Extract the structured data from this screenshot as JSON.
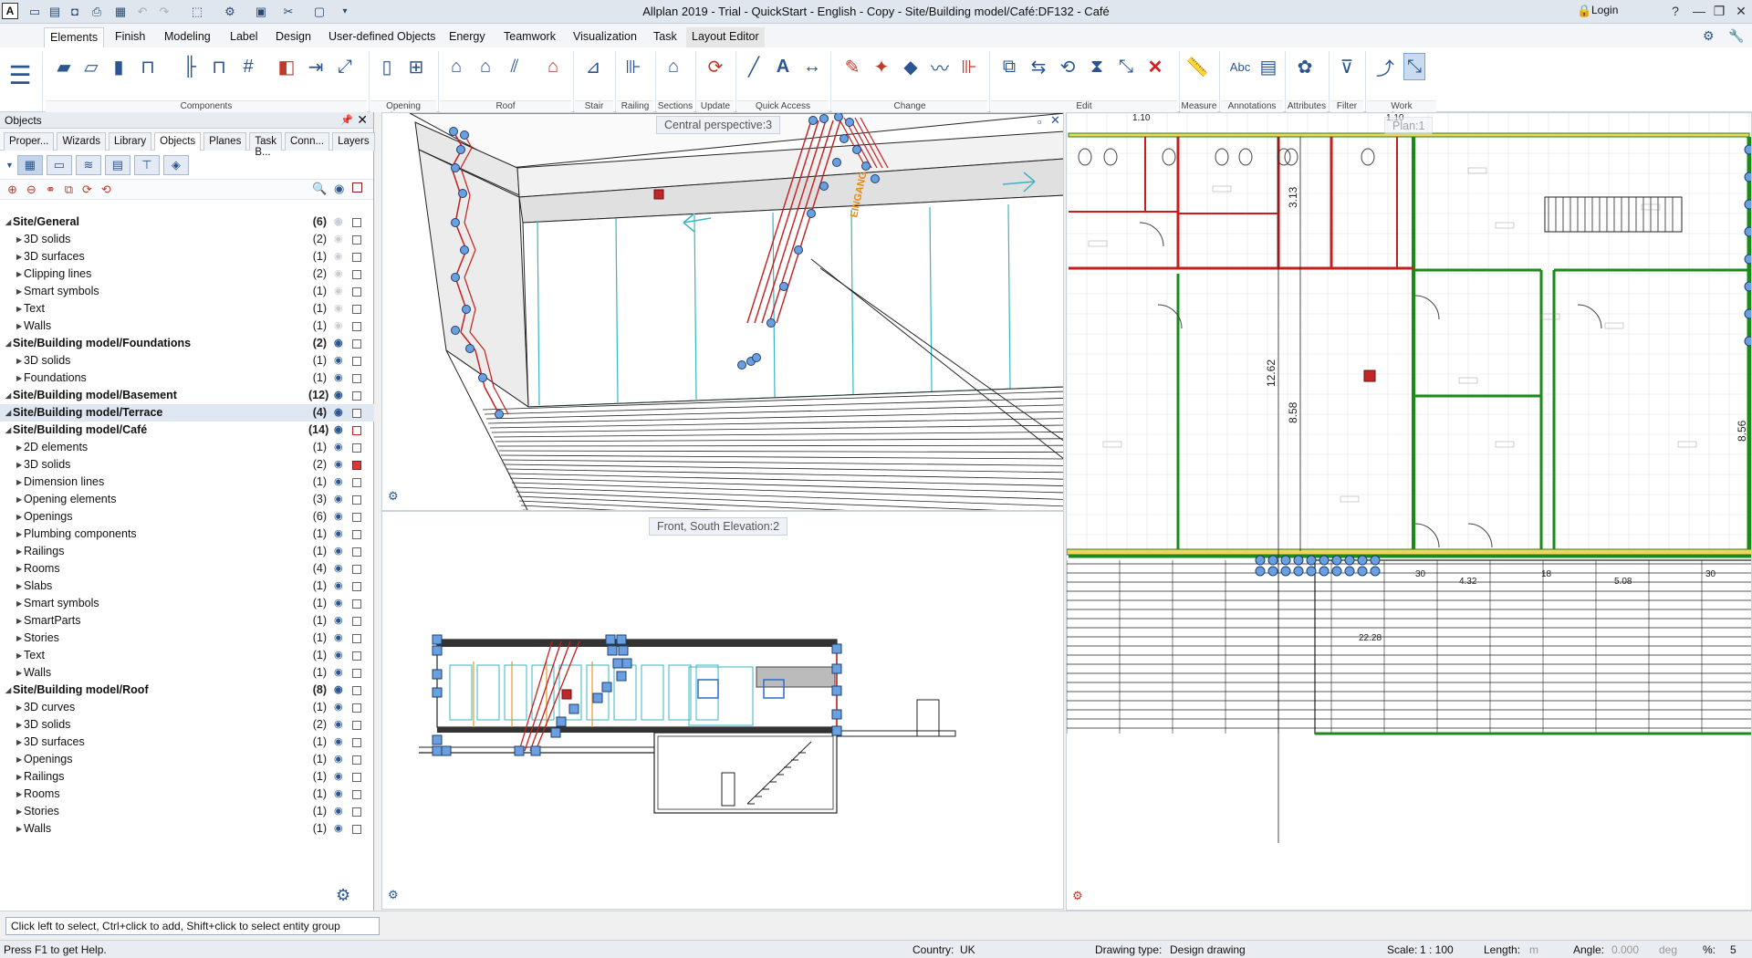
{
  "window": {
    "title": "Allplan 2019 - Trial - QuickStart - English - Copy - Site/Building model/Café:DF132 - Café",
    "app_icon": "A",
    "login_label": "Login",
    "help_label": "?"
  },
  "ribbon_tabs": [
    "Elements",
    "Finish",
    "Modeling",
    "Label",
    "Design",
    "User-defined Objects",
    "Energy",
    "Teamwork",
    "Visualization",
    "Task",
    "Layout Editor"
  ],
  "ribbon_groups": [
    {
      "label": "Components"
    },
    {
      "label": "Opening Elements"
    },
    {
      "label": "Roof"
    },
    {
      "label": "Stair"
    },
    {
      "label": "Railing"
    },
    {
      "label": "Sections"
    },
    {
      "label": "Update"
    },
    {
      "label": "Quick Access"
    },
    {
      "label": "Change"
    },
    {
      "label": "Edit"
    },
    {
      "label": "Measure"
    },
    {
      "label": "Annotations"
    },
    {
      "label": "Attributes"
    },
    {
      "label": "Filter"
    },
    {
      "label": "Work Environment"
    }
  ],
  "ribbon_annotation_text": "Abc",
  "panel": {
    "title": "Objects",
    "tabs": [
      "Proper...",
      "Wizards",
      "Library",
      "Objects",
      "Planes",
      "Task B...",
      "Conn...",
      "Layers"
    ],
    "active_tab": "Objects"
  },
  "tree": [
    {
      "label": "Site/General",
      "count": "(6)",
      "level": 0,
      "group": true,
      "eye": "dim"
    },
    {
      "label": "3D solids",
      "count": "(2)",
      "level": 1,
      "eye": "dim"
    },
    {
      "label": "3D surfaces",
      "count": "(1)",
      "level": 1,
      "eye": "dim"
    },
    {
      "label": "Clipping lines",
      "count": "(2)",
      "level": 1,
      "eye": "dim"
    },
    {
      "label": "Smart symbols",
      "count": "(1)",
      "level": 1,
      "eye": "dim"
    },
    {
      "label": "Text",
      "count": "(1)",
      "level": 1,
      "eye": "dim"
    },
    {
      "label": "Walls",
      "count": "(1)",
      "level": 1,
      "eye": "dim"
    },
    {
      "label": "Site/Building model/Foundations",
      "count": "(2)",
      "level": 0,
      "group": true
    },
    {
      "label": "3D solids",
      "count": "(1)",
      "level": 1
    },
    {
      "label": "Foundations",
      "count": "(1)",
      "level": 1
    },
    {
      "label": "Site/Building model/Basement",
      "count": "(12)",
      "level": 0,
      "group": true
    },
    {
      "label": "Site/Building model/Terrace",
      "count": "(4)",
      "level": 0,
      "group": true,
      "highlight": true
    },
    {
      "label": "Site/Building model/Café",
      "count": "(14)",
      "level": 0,
      "group": true,
      "check": "redc"
    },
    {
      "label": "2D elements",
      "count": "(1)",
      "level": 1
    },
    {
      "label": "3D solids",
      "count": "(2)",
      "level": 1,
      "check": "red"
    },
    {
      "label": "Dimension lines",
      "count": "(1)",
      "level": 1
    },
    {
      "label": "Opening elements",
      "count": "(3)",
      "level": 1
    },
    {
      "label": "Openings",
      "count": "(6)",
      "level": 1
    },
    {
      "label": "Plumbing components",
      "count": "(1)",
      "level": 1
    },
    {
      "label": "Railings",
      "count": "(1)",
      "level": 1
    },
    {
      "label": "Rooms",
      "count": "(4)",
      "level": 1
    },
    {
      "label": "Slabs",
      "count": "(1)",
      "level": 1
    },
    {
      "label": "Smart symbols",
      "count": "(1)",
      "level": 1
    },
    {
      "label": "SmartParts",
      "count": "(1)",
      "level": 1
    },
    {
      "label": "Stories",
      "count": "(1)",
      "level": 1
    },
    {
      "label": "Text",
      "count": "(1)",
      "level": 1
    },
    {
      "label": "Walls",
      "count": "(1)",
      "level": 1
    },
    {
      "label": "Site/Building model/Roof",
      "count": "(8)",
      "level": 0,
      "group": true
    },
    {
      "label": "3D curves",
      "count": "(1)",
      "level": 1
    },
    {
      "label": "3D solids",
      "count": "(2)",
      "level": 1
    },
    {
      "label": "3D surfaces",
      "count": "(1)",
      "level": 1
    },
    {
      "label": "Openings",
      "count": "(1)",
      "level": 1
    },
    {
      "label": "Railings",
      "count": "(1)",
      "level": 1
    },
    {
      "label": "Rooms",
      "count": "(1)",
      "level": 1
    },
    {
      "label": "Stories",
      "count": "(1)",
      "level": 1
    },
    {
      "label": "Walls",
      "count": "(1)",
      "level": 1
    }
  ],
  "viewports": {
    "perspective": {
      "label": "Central perspective:3",
      "sign_text": "EINGANG"
    },
    "elevation": {
      "label": "Front, South Elevation:2"
    },
    "plan": {
      "label": "Plan:1",
      "dims_vertical": [
        "3.13",
        "12.62",
        "8.58",
        "8.56"
      ],
      "dims_horizontal": [
        "4.32",
        "5.08",
        "22.28",
        "30",
        "18",
        "30",
        "1.10",
        "1.10"
      ]
    }
  },
  "status": {
    "prompt": "Click left to select, Ctrl+click to add, Shift+click to select entity group",
    "help": "Press F1 to get Help.",
    "country_label": "Country:",
    "country": "UK",
    "drawing_type_label": "Drawing type:",
    "drawing_type": "Design drawing",
    "scale_label": "Scale:",
    "scale": "1 : 100",
    "length_label": "Length:",
    "length_unit": "m",
    "angle_label": "Angle:",
    "angle": "0.000",
    "angle_unit": "deg",
    "percent_label": "%:",
    "percent": "5"
  },
  "colors": {
    "accent": "#2a5590",
    "wall_red": "#c41e1e",
    "wall_green": "#1a8a1a",
    "handle_blue": "#6aa0e0"
  }
}
